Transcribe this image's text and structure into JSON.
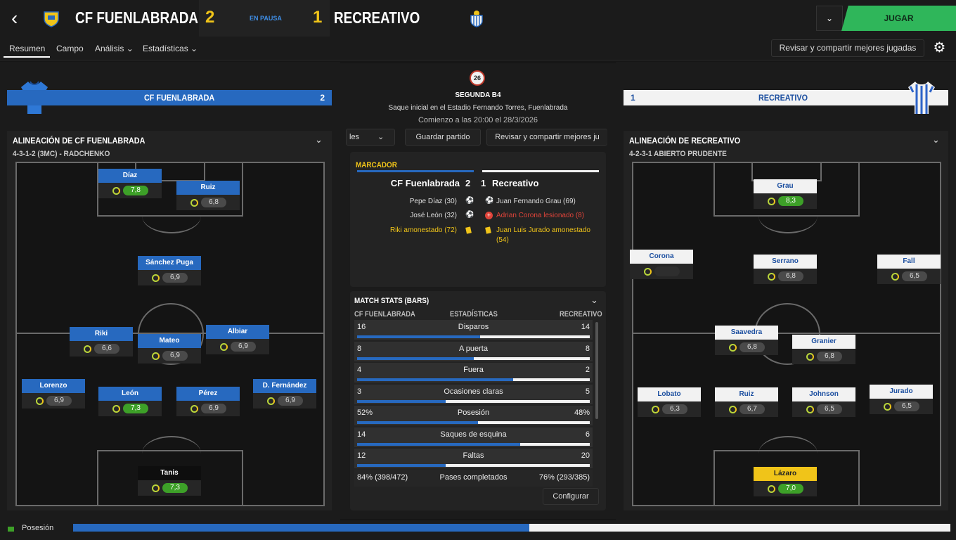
{
  "header": {
    "home_team": "CF FUENLABRADA",
    "away_team": "RECREATIVO",
    "home_score": "2",
    "away_score": "1",
    "status": "EN PAUSA",
    "play_button": "JUGAR"
  },
  "nav": {
    "tabs": [
      "Resumen",
      "Campo",
      "Análisis",
      "Estadísticas"
    ],
    "review_button": "Revisar y compartir mejores jugadas"
  },
  "home": {
    "band_name": "CF FUENLABRADA",
    "band_score": "2",
    "lineup_title": "ALINEACIÓN DE CF FUENLABRADA",
    "formation": "4-3-1-2 (3MC) - RADCHENKO",
    "players": [
      {
        "name": "Díaz",
        "rating": "7,8",
        "green": true
      },
      {
        "name": "Ruiz",
        "rating": "6,8",
        "green": false
      },
      {
        "name": "Sánchez Puga",
        "rating": "6,9",
        "green": false
      },
      {
        "name": "Riki",
        "rating": "6,6",
        "green": false
      },
      {
        "name": "Mateo",
        "rating": "6,9",
        "green": false
      },
      {
        "name": "Albiar",
        "rating": "6,9",
        "green": false
      },
      {
        "name": "Lorenzo",
        "rating": "6,9",
        "green": false
      },
      {
        "name": "León",
        "rating": "7,3",
        "green": true
      },
      {
        "name": "Pérez",
        "rating": "6,9",
        "green": false
      },
      {
        "name": "D. Fernández",
        "rating": "6,9",
        "green": false
      },
      {
        "name": "Tanis",
        "rating": "7,3",
        "green": true
      }
    ]
  },
  "away": {
    "band_name": "RECREATIVO",
    "band_score": "1",
    "lineup_title": "ALINEACIÓN DE RECREATIVO",
    "formation": "4-2-3-1 ABIERTO PRUDENTE",
    "players": [
      {
        "name": "Grau",
        "rating": "8,3",
        "green": true
      },
      {
        "name": "Corona",
        "rating": "",
        "green": false
      },
      {
        "name": "Serrano",
        "rating": "6,8",
        "green": false
      },
      {
        "name": "Fall",
        "rating": "6,5",
        "green": false
      },
      {
        "name": "Saavedra",
        "rating": "6,8",
        "green": false
      },
      {
        "name": "Granier",
        "rating": "6,8",
        "green": false
      },
      {
        "name": "Lobato",
        "rating": "6,3",
        "green": false
      },
      {
        "name": "Ruiz",
        "rating": "6,7",
        "green": false
      },
      {
        "name": "Johnson",
        "rating": "6,5",
        "green": false
      },
      {
        "name": "Jurado",
        "rating": "6,5",
        "green": false
      },
      {
        "name": "Lázaro",
        "rating": "7,0",
        "green": true
      }
    ]
  },
  "match": {
    "competition_badge": "26",
    "competition": "SEGUNDA B4",
    "venue": "Saque inicial en el Estadio Fernando Torres, Fuenlabrada",
    "kickoff": "Comienzo a las 20:00 el 28/3/2026",
    "btn_partial": "les",
    "btn_save": "Guardar partido",
    "btn_review": "Revisar y compartir mejores ju"
  },
  "scoreboard": {
    "title": "MARCADOR",
    "home_name": "CF Fuenlabrada",
    "home_score": "2",
    "away_score": "1",
    "away_name": "Recreativo",
    "home_events": [
      "Pepe Díaz (30)",
      "José León (32)",
      "Riki amonestado (72)"
    ],
    "away_events": [
      "Juan Fernando Grau (69)",
      "Adrian Corona lesionado (8)",
      "Juan Luis Jurado amonestado",
      "(54)"
    ]
  },
  "stats": {
    "title": "MATCH STATS (BARS)",
    "col_home": "CF FUENLABRADA",
    "col_mid": "ESTADÍSTICAS",
    "col_away": "RECREATIVO",
    "rows": [
      {
        "label": "Disparos",
        "home": "16",
        "away": "14",
        "share": 0.53
      },
      {
        "label": "A puerta",
        "home": "8",
        "away": "8",
        "share": 0.5
      },
      {
        "label": "Fuera",
        "home": "4",
        "away": "2",
        "share": 0.67
      },
      {
        "label": "Ocasiones claras",
        "home": "3",
        "away": "5",
        "share": 0.38
      },
      {
        "label": "Posesión",
        "home": "52%",
        "away": "48%",
        "share": 0.52
      },
      {
        "label": "Saques de esquina",
        "home": "14",
        "away": "6",
        "share": 0.7
      },
      {
        "label": "Faltas",
        "home": "12",
        "away": "20",
        "share": 0.38
      }
    ],
    "passes": {
      "label": "Pases completados",
      "home": "84% (398/472)",
      "away": "76% (293/385)"
    },
    "config_button": "Configurar"
  },
  "bottom": {
    "label": "Posesión",
    "home_share": 0.52
  },
  "colors": {
    "home_blue": "#2769bf",
    "accent_yellow": "#f0c419",
    "play_green": "#2fb65a"
  }
}
